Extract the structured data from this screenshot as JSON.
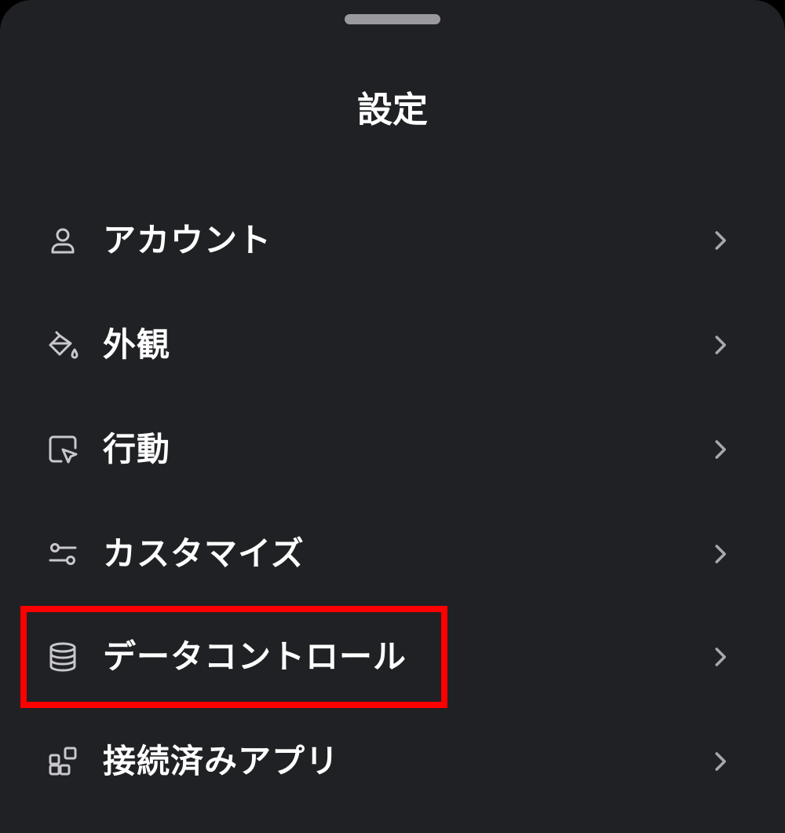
{
  "sheet": {
    "title": "設定"
  },
  "menu": {
    "items": [
      {
        "id": "account",
        "label": "アカウント",
        "icon": "person-icon"
      },
      {
        "id": "appearance",
        "label": "外観",
        "icon": "paint-bucket-icon"
      },
      {
        "id": "behavior",
        "label": "行動",
        "icon": "cursor-window-icon"
      },
      {
        "id": "customize",
        "label": "カスタマイズ",
        "icon": "sliders-icon"
      },
      {
        "id": "data-controls",
        "label": "データコントロール",
        "icon": "database-icon"
      },
      {
        "id": "connected-apps",
        "label": "接続済みアプリ",
        "icon": "apps-grid-icon"
      }
    ],
    "highlighted_item": "data-controls"
  },
  "colors": {
    "background": "#202124",
    "text": "#ffffff",
    "icon": "#c8c8cc",
    "chevron": "#a8a8ad",
    "handle": "#9a9a9e",
    "highlight": "#ff0000"
  }
}
